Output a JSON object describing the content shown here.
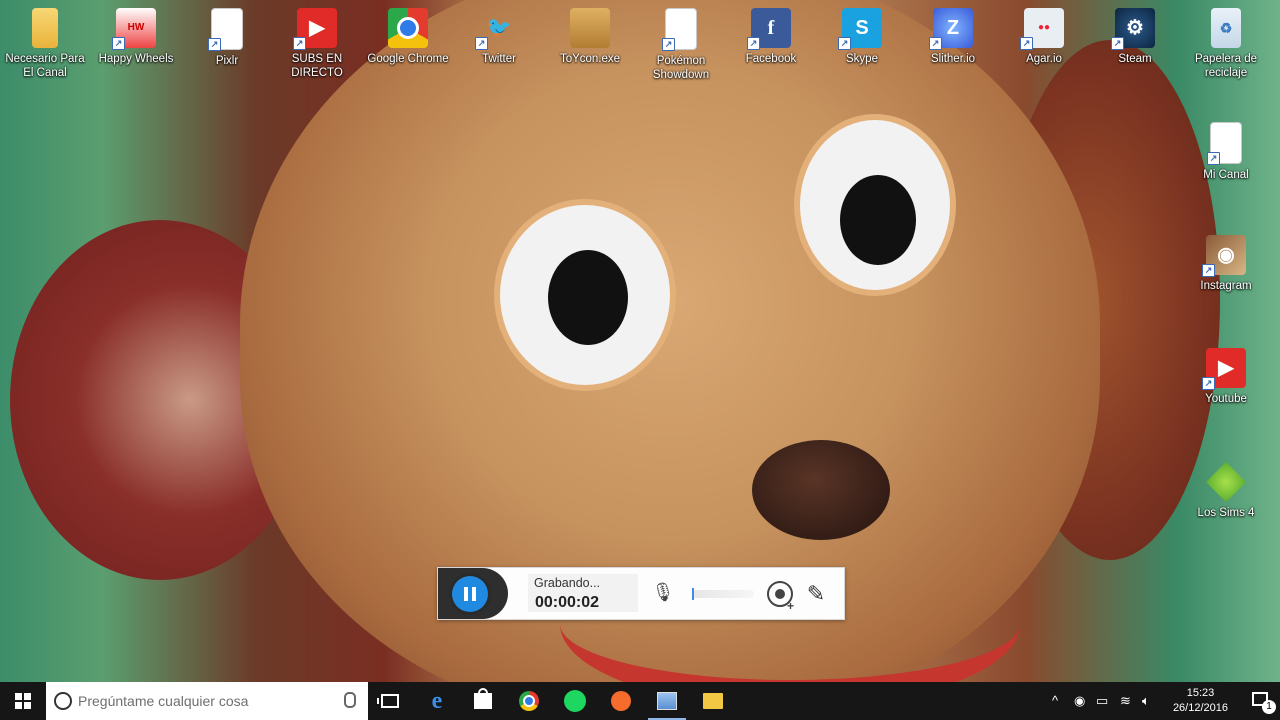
{
  "desktop": {
    "icons_top": [
      {
        "label": "Necesario Para El Canal",
        "icon": "folder-icon"
      },
      {
        "label": "Happy Wheels",
        "icon": "happy-wheels-icon"
      },
      {
        "label": "Pixlr",
        "icon": "document-icon"
      },
      {
        "label": "SUBS EN DIRECTO",
        "icon": "youtube-icon"
      },
      {
        "label": "Google Chrome",
        "icon": "chrome-icon"
      },
      {
        "label": "Twitter",
        "icon": "twitter-icon"
      },
      {
        "label": "ToYcon.exe",
        "icon": "box-icon"
      },
      {
        "label": "Pokémon Showdown",
        "icon": "document-icon"
      },
      {
        "label": "Facebook",
        "icon": "facebook-icon"
      },
      {
        "label": "Skype",
        "icon": "skype-icon"
      },
      {
        "label": "Slither.io",
        "icon": "slither-icon"
      },
      {
        "label": "Agar.io",
        "icon": "agar-icon"
      },
      {
        "label": "Steam",
        "icon": "steam-icon"
      },
      {
        "label": "Papelera de reciclaje",
        "icon": "recycle-bin-icon"
      }
    ],
    "icons_right": [
      {
        "label": "Mi Canal",
        "icon": "document-icon"
      },
      {
        "label": "Instagram",
        "icon": "instagram-icon"
      },
      {
        "label": "Youtube",
        "icon": "youtube-icon"
      },
      {
        "label": "Los Sims 4",
        "icon": "sims-icon"
      }
    ]
  },
  "recorder": {
    "status": "Grabando...",
    "time": "00:00:02",
    "volume": 0.02
  },
  "taskbar": {
    "search_placeholder": "Pregúntame cualquier cosa",
    "clock_time": "15:23",
    "clock_date": "26/12/2016",
    "notification_count": "1"
  }
}
